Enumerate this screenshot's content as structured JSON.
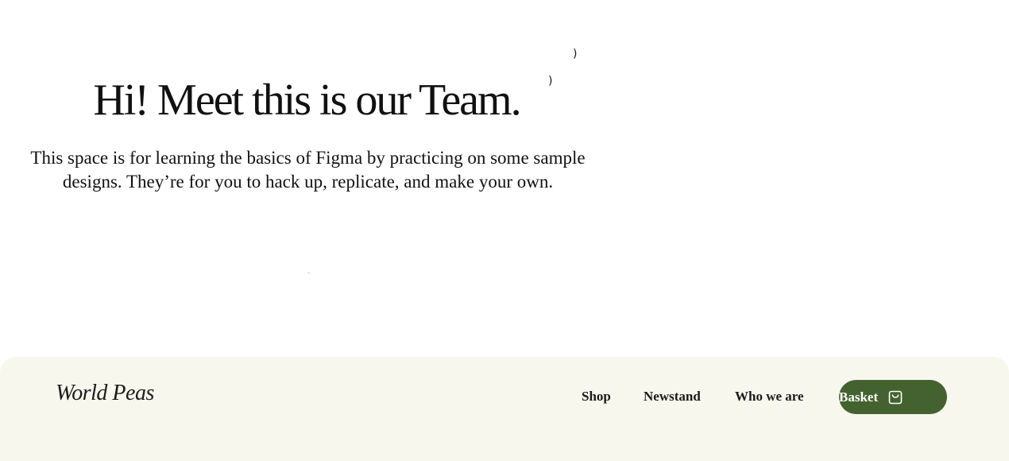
{
  "hero": {
    "title": "Hi! Meet this is our Team.",
    "subtitle_line1": "This space is for learning the basics of Figma by practicing on some sample",
    "subtitle_line2": "designs. They’re for you to hack up, replicate, and make your own.",
    "stray_mark_1": ")",
    "stray_mark_2": ")"
  },
  "footer": {
    "brand": "World Peas",
    "nav": {
      "shop": "Shop",
      "newstand": "Newstand",
      "who_we_are": "Who we are"
    },
    "basket": {
      "label": "Basket",
      "icon": "shopping-bag-icon",
      "color": "#44622f"
    },
    "background": "#f7f7ee"
  }
}
